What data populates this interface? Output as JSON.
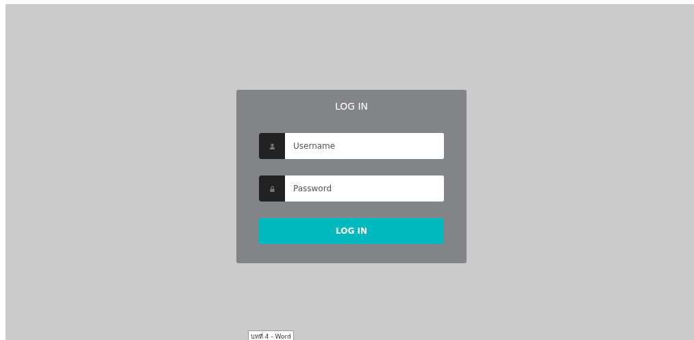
{
  "login_form": {
    "title": "LOG IN",
    "fields": [
      {
        "kind": "user",
        "placeholder": "Username"
      },
      {
        "kind": "lock",
        "placeholder": "Password"
      }
    ],
    "submit_button": "LOG IN"
  },
  "tooltip": "บทที่ 4 - Word"
}
